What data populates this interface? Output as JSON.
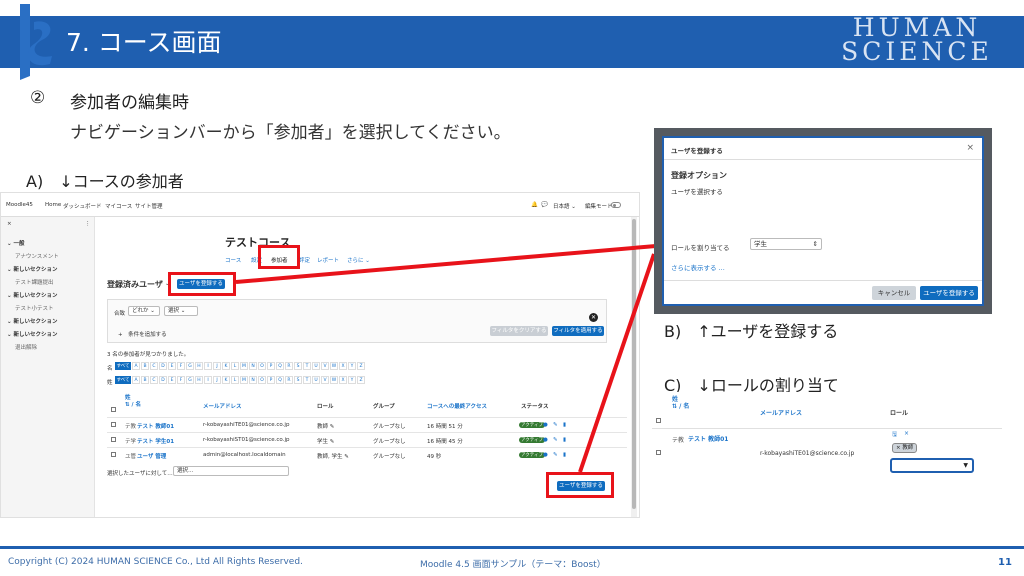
{
  "header": {
    "title": "7. コース画面",
    "brand_line1": "HUMAN",
    "brand_line2": "SCIENCE",
    "colors": {
      "band": "#1f5fb0",
      "highlight": "#e8131a"
    }
  },
  "section": {
    "number": "②",
    "title": "参加者の編集時",
    "description": "ナビゲーションバーから「参加者」を選択してください。"
  },
  "labels": {
    "a": "A)　↓コースの参加者",
    "b": "B)　↑ユーザを登録する",
    "c": "C)　↓ロールの割り当て"
  },
  "shot_a": {
    "topbar": {
      "site": "Moodle45",
      "nav": [
        "Home",
        "ダッシュボード",
        "マイコース",
        "サイト管理"
      ],
      "lang": "日本語 ⌄",
      "edit_mode": "編集モード"
    },
    "sidebar": {
      "close": "×",
      "menu": "⋮",
      "items": [
        {
          "label": "⌄ 一般",
          "kind": "bold"
        },
        {
          "label": "アナウンスメント",
          "kind": "sub"
        },
        {
          "label": "⌄ 新しいセクション",
          "kind": "bold"
        },
        {
          "label": "テスト課題提出",
          "kind": "sub"
        },
        {
          "label": "⌄ 新しいセクション",
          "kind": "bold"
        },
        {
          "label": "テスト小テスト",
          "kind": "sub"
        },
        {
          "label": "⌄ 新しいセクション",
          "kind": "bold"
        },
        {
          "label": "⌄ 新しいセクション",
          "kind": "bold"
        },
        {
          "label": "退出解除",
          "kind": "sub"
        }
      ]
    },
    "course_title": "テストコース",
    "tabs": [
      "コース",
      "設定",
      "参加者",
      "評定",
      "レポート",
      "さらに ⌄"
    ],
    "page_heading": "登録済みユーザ",
    "heading_chevron": "⌄",
    "enrol_button": "ユーザを登録する",
    "filter": {
      "match_label": "合致",
      "match_value": "どれか ⌄",
      "select_value": "選択 ⌄",
      "add_condition": "+　条件を追加する",
      "clear_button": "フィルタをクリアする",
      "apply_button": "フィルタを適用する",
      "close": "✕"
    },
    "found_text": "3 名の参加者が見つかりました。",
    "first_name_label": "名",
    "last_name_label": "姓",
    "all_label": "すべて",
    "letters": [
      "A",
      "B",
      "C",
      "D",
      "E",
      "F",
      "G",
      "H",
      "I",
      "J",
      "K",
      "L",
      "M",
      "N",
      "O",
      "P",
      "Q",
      "R",
      "S",
      "T",
      "U",
      "V",
      "W",
      "X",
      "Y",
      "Z"
    ],
    "columns": {
      "name": "姓\n⇅ / 名",
      "email": "メールアドレス",
      "roles": "ロール",
      "groups": "グループ",
      "last_access": "コースへの最終アクセス",
      "status": "ステータス"
    },
    "rows": [
      {
        "initials": "テ教",
        "name": "テスト 教師01",
        "email": "r-kobayashiTE01@science.co.jp",
        "role": "教師 ✎",
        "group": "グループなし",
        "access": "16 時間 51 分",
        "status": "アクティブ"
      },
      {
        "initials": "テ学",
        "name": "テスト 学生01",
        "email": "r-kobayashiST01@science.co.jp",
        "role": "学生 ✎",
        "group": "グループなし",
        "access": "16 時間 45 分",
        "status": "アクティブ"
      },
      {
        "initials": "ユ管",
        "name": "ユーザ 管理",
        "email": "admin@localhost.localdomain",
        "role": "教師, 学生 ✎",
        "group": "グループなし",
        "access": "49 秒",
        "status": "アクティブ"
      }
    ],
    "bulk_label": "選択したユーザに対して…",
    "bulk_select": "選択…"
  },
  "shot_b": {
    "modal_title": "ユーザを登録する",
    "close": "×",
    "section_title": "登録オプション",
    "select_users": "ユーザを選択する",
    "assign_role_label": "ロールを割り当てる",
    "role_value": "学生",
    "show_more": "さらに表示する ...",
    "cancel": "キャンセル",
    "submit": "ユーザを登録する"
  },
  "shot_c": {
    "col_name": "姓\n⇅ / 名",
    "col_email": "メールアドレス",
    "col_role": "ロール",
    "initials": "テ教",
    "user": "テスト 教師01",
    "email": "r-kobayashiTE01@science.co.jp",
    "role_tag": "× 教師",
    "save_icon_glyph": "🖫",
    "cancel_glyph": "×"
  },
  "footer": {
    "copyright": "Copyright (C) 2024 HUMAN SCIENCE Co., Ltd All Rights Reserved.",
    "center": "Moodle 4.5 画面サンプル（テーマ：Boost）",
    "page": "11"
  }
}
